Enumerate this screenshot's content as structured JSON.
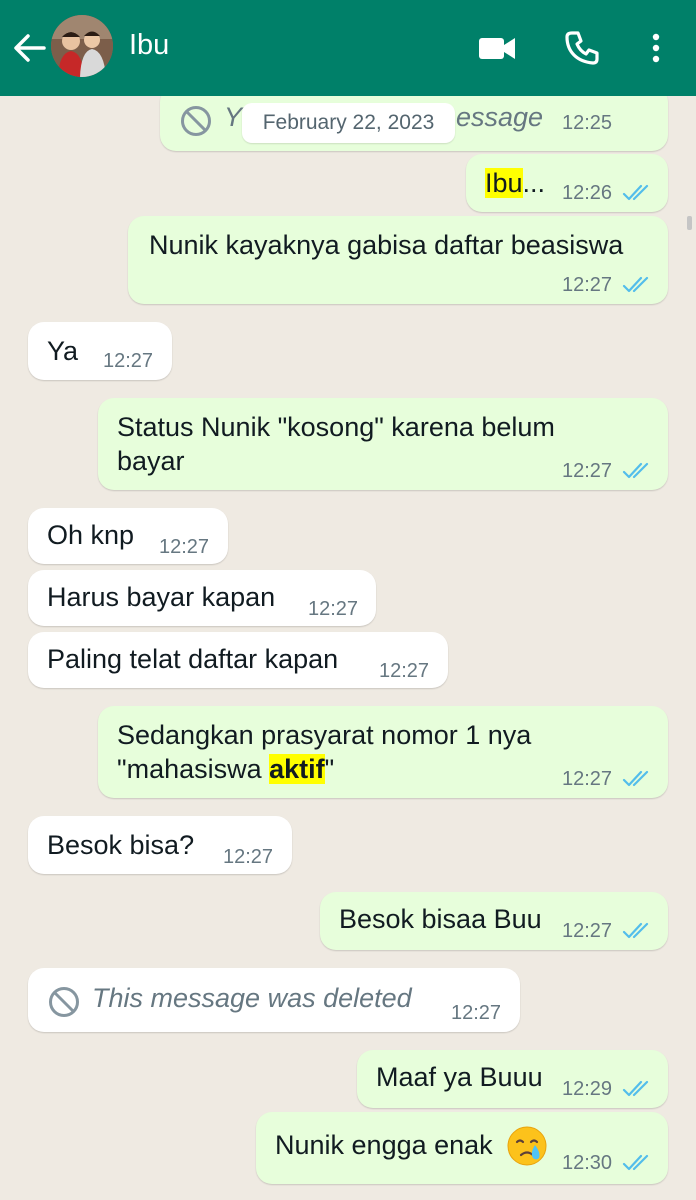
{
  "header": {
    "contact_name": "Ibu"
  },
  "date_chip": "February 22, 2023",
  "messages": [
    {
      "dir": "out",
      "deleted": true,
      "text_visible": "Y",
      "text_tail": "essage",
      "time": "12:25"
    },
    {
      "dir": "out",
      "highlight": "Ibu",
      "text": "...",
      "time": "12:26"
    },
    {
      "dir": "out",
      "text": "Nunik kayaknya gabisa daftar beasiswa",
      "time": "12:27"
    },
    {
      "dir": "in",
      "text": "Ya",
      "time": "12:27"
    },
    {
      "dir": "out",
      "text": "Status Nunik \"kosong\" karena belum bayar",
      "time": "12:27"
    },
    {
      "dir": "in",
      "text": "Oh knp",
      "time": "12:27"
    },
    {
      "dir": "in",
      "text": "Harus bayar kapan",
      "time": "12:27"
    },
    {
      "dir": "in",
      "text": "Paling telat daftar kapan",
      "time": "12:27"
    },
    {
      "dir": "out",
      "text_before": "Sedangkan prasyarat nomor 1 nya \"mahasiswa ",
      "highlight": "aktif",
      "text_after": "\"",
      "time": "12:27"
    },
    {
      "dir": "in",
      "text": "Besok bisa?",
      "time": "12:27"
    },
    {
      "dir": "out",
      "text": "Besok bisaa Buu",
      "time": "12:27"
    },
    {
      "dir": "in",
      "deleted": true,
      "text": "This message was deleted",
      "time": "12:27"
    },
    {
      "dir": "out",
      "text": "Maaf ya Buuu",
      "time": "12:29"
    },
    {
      "dir": "out",
      "text": "Nunik engga enak",
      "emoji": "crying-face",
      "time": "12:30"
    }
  ],
  "colors": {
    "header": "#008069",
    "chat_background": "#efeae2",
    "outgoing_bubble": "#e7fedb",
    "incoming_bubble": "#ffffff",
    "read_tick": "#53bdeb",
    "highlight": "#ffff00"
  },
  "icons": [
    "back-arrow-icon",
    "video-call-icon",
    "phone-icon",
    "more-vert-icon",
    "blocked-icon",
    "double-check-icon",
    "crying-face-emoji"
  ]
}
